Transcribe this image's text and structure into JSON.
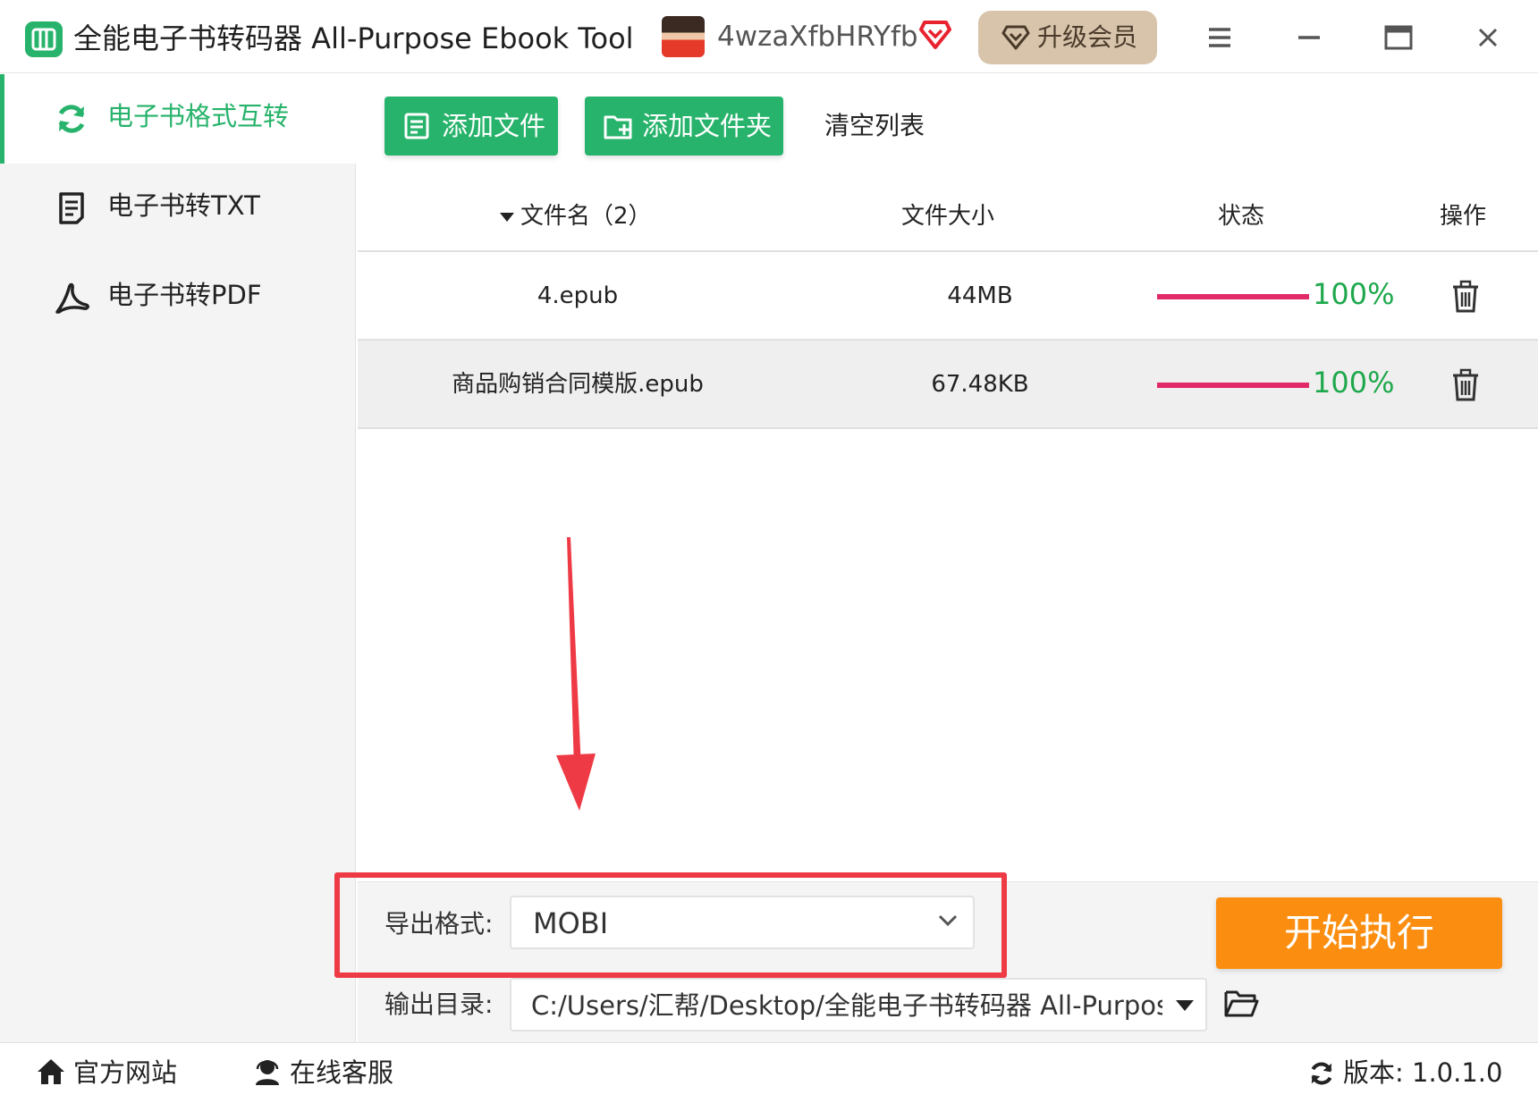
{
  "app": {
    "title": "全能电子书转码器 All-Purpose Ebook Tool",
    "username": "4wzaXfbHRYfb",
    "upgrade_label": "升级会员"
  },
  "sidebar": {
    "items": [
      {
        "label": "电子书格式互转",
        "icon": "refresh-icon",
        "active": true
      },
      {
        "label": "电子书转TXT",
        "icon": "document-icon",
        "active": false
      },
      {
        "label": "电子书转PDF",
        "icon": "acrobat-icon",
        "active": false
      }
    ]
  },
  "toolbar": {
    "add_file_label": "添加文件",
    "add_folder_label": "添加文件夹",
    "clear_label": "清空列表"
  },
  "table": {
    "columns": [
      "文件名（2）",
      "文件大小",
      "状态",
      "操作"
    ],
    "rows": [
      {
        "name": "4.epub",
        "size": "44MB",
        "progress": "100%"
      },
      {
        "name": "商品购销合同模版.epub",
        "size": "67.48KB",
        "progress": "100%"
      }
    ]
  },
  "bottom": {
    "export_label": "导出格式:",
    "export_value": "MOBI",
    "output_label": "输出目录:",
    "output_value": "C:/Users/汇帮/Desktop/全能电子书转码器 All-Purpose Ebook Tool",
    "start_label": "开始执行"
  },
  "footer": {
    "website_label": "官方网站",
    "support_label": "在线客服",
    "version_label": "版本: 1.0.1.0"
  },
  "colors": {
    "brand_green": "#27b36b",
    "progress_bar": "#e22a6a",
    "progress_text": "#1ea84c",
    "start_button": "#fb8e10",
    "upgrade_button": "#d8c4ab",
    "annotation_red": "#ee3a45"
  }
}
